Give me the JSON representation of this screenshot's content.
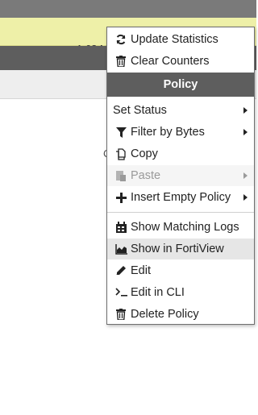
{
  "background": {
    "bytes_value": "1.68 M",
    "cell_fragment": "C"
  },
  "menu": {
    "top_items": [
      {
        "label": "Update Statistics",
        "icon": "refresh-icon"
      },
      {
        "label": "Clear Counters",
        "icon": "trash-icon"
      }
    ],
    "header": "Policy",
    "policy_items": [
      {
        "label": "Set Status",
        "submenu": true
      },
      {
        "label": "Filter by Bytes",
        "icon": "filter-icon",
        "submenu": true
      },
      {
        "label": "Copy",
        "icon": "copy-icon"
      },
      {
        "label": "Paste",
        "icon": "paste-icon",
        "submenu": true,
        "disabled": true
      },
      {
        "label": "Insert Empty Policy",
        "icon": "plus-icon",
        "submenu": true
      }
    ],
    "other_items": [
      {
        "label": "Show Matching Logs",
        "icon": "log-icon"
      },
      {
        "label": "Show in FortiView",
        "icon": "area-chart-icon",
        "highlighted": true
      },
      {
        "label": "Edit",
        "icon": "pencil-icon"
      },
      {
        "label": "Edit in CLI",
        "icon": "terminal-icon"
      },
      {
        "label": "Delete Policy",
        "icon": "trash-icon"
      }
    ]
  },
  "colors": {
    "header_bg": "#5e5e5e",
    "row_highlight": "#eef0a8",
    "menu_hover": "#e6e6e6"
  }
}
